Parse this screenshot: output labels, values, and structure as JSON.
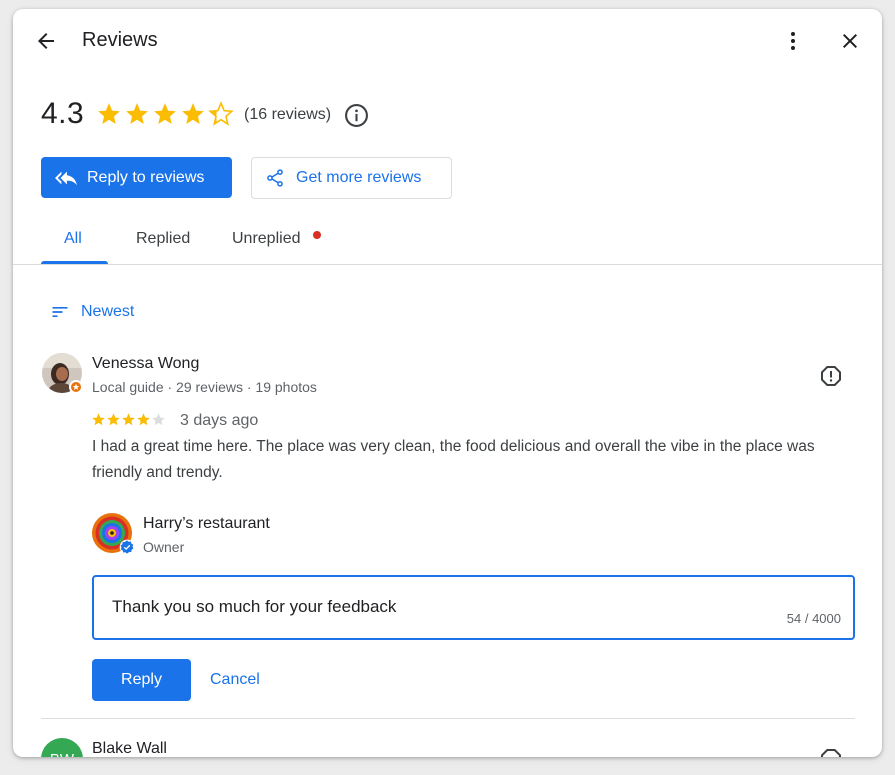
{
  "header": {
    "title": "Reviews",
    "back_icon": "arrow-back-icon",
    "more_icon": "more-vert-icon",
    "close_icon": "close-icon"
  },
  "summary": {
    "rating": "4.3",
    "rating_value": 4.3,
    "max_stars": 5,
    "review_count": "(16 reviews)",
    "info_icon": "info-icon"
  },
  "actions": {
    "reply_to_reviews": "Reply to reviews",
    "get_more_reviews": "Get more reviews"
  },
  "tabs": [
    {
      "label": "All",
      "active": true
    },
    {
      "label": "Replied",
      "active": false
    },
    {
      "label": "Unreplied",
      "active": false,
      "dot": true
    }
  ],
  "sort": {
    "label": "Newest",
    "icon": "sort-icon"
  },
  "reviews": [
    {
      "author": "Venessa Wong",
      "meta": "Local guide · 29 reviews · 19 photos",
      "stars": 4,
      "time": "3 days ago",
      "text": "I had a great time here. The place was very clean, the food delicious and overall the vibe in the place was friendly and trendy.",
      "report_icon": "report-icon",
      "owner_reply": {
        "name": "Harry’s restaurant",
        "role": "Owner",
        "draft": "Thank you so much for your feedback",
        "char_count": "54 / 4000",
        "reply_label": "Reply",
        "cancel_label": "Cancel"
      }
    },
    {
      "author": "Blake Wall",
      "initials": "BW",
      "avatar_color": "#34a853"
    }
  ],
  "colors": {
    "accent": "#1a73e8",
    "star": "#fbbc04",
    "star_empty": "#dadce0",
    "notification_dot": "#d93025",
    "local_guide_badge": "#e8710a"
  }
}
